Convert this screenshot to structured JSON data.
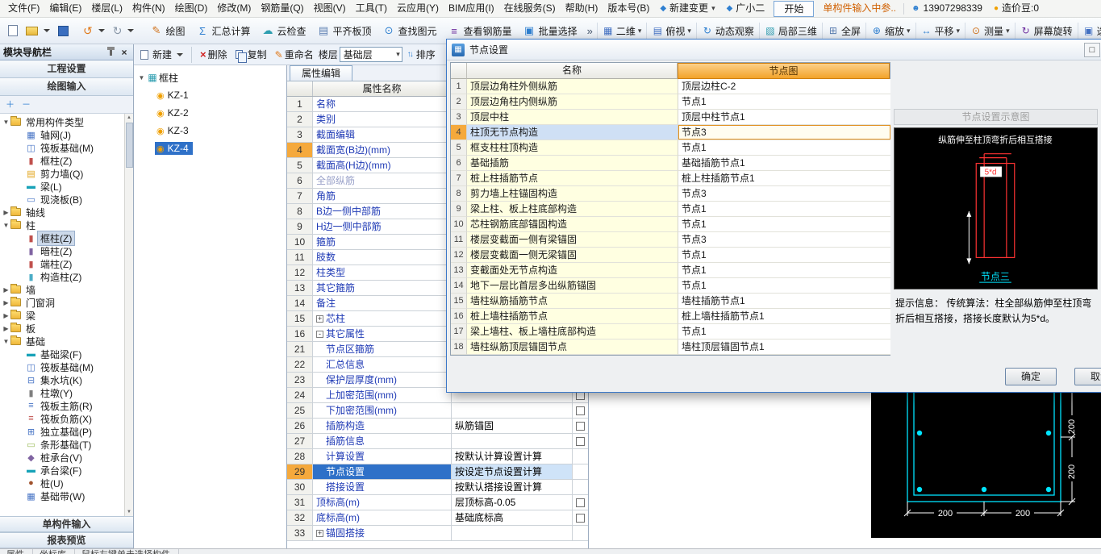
{
  "menubar": {
    "items": [
      "文件(F)",
      "编辑(E)",
      "楼层(L)",
      "构件(N)",
      "绘图(D)",
      "修改(M)",
      "钢筋量(Q)",
      "视图(V)",
      "工具(T)",
      "云应用(Y)",
      "BIM应用(I)",
      "在线服务(S)",
      "帮助(H)",
      "版本号(B)"
    ],
    "new_change": "新建变更",
    "assistant": "广小二",
    "start_tab": "开始",
    "notice": "单构件输入中参..",
    "phone": "13907298339",
    "coin": "造价豆:0"
  },
  "toolbar": {
    "items": [
      {
        "label": "绘图",
        "glyph": "✎",
        "color": "#d07018"
      },
      {
        "label": "汇总计算",
        "glyph": "Σ",
        "color": "#2e7fd0"
      },
      {
        "label": "云检查",
        "glyph": "☁",
        "color": "#2e9eb0"
      },
      {
        "label": "平齐板顶",
        "glyph": "▤",
        "color": "#5a7db0"
      },
      {
        "label": "查找图元",
        "glyph": "⊙",
        "color": "#2e7fd0"
      },
      {
        "label": "查看钢筋量",
        "glyph": "≡",
        "color": "#7030a0"
      },
      {
        "label": "批量选择",
        "glyph": "▣",
        "color": "#2e7fd0"
      }
    ],
    "view_items": [
      {
        "label": "二维",
        "glyph": "▦",
        "color": "#4472c4",
        "arrow": "▾"
      },
      {
        "label": "俯视",
        "glyph": "▤",
        "color": "#4472c4",
        "arrow": "▾"
      },
      {
        "label": "动态观察",
        "glyph": "↻",
        "color": "#2e7fd0",
        "arrow": ""
      },
      {
        "label": "局部三维",
        "glyph": "▧",
        "color": "#2e9eb0",
        "arrow": ""
      },
      {
        "label": "全屏",
        "glyph": "⊞",
        "color": "#5a7db0",
        "arrow": ""
      },
      {
        "label": "缩放",
        "glyph": "⊕",
        "color": "#2e7fd0",
        "arrow": "▾"
      },
      {
        "label": "平移",
        "glyph": "↔",
        "color": "#2e7fd0",
        "arrow": "▾"
      },
      {
        "label": "测量",
        "glyph": "⊙",
        "color": "#d07018",
        "arrow": "▾"
      },
      {
        "label": "屏幕旋转",
        "glyph": "↻",
        "color": "#7030a0",
        "arrow": ""
      },
      {
        "label": "选择样式",
        "glyph": "▣",
        "color": "#4472c4",
        "arrow": ""
      }
    ]
  },
  "glyphs": {
    "close": "×",
    "maximize": "□",
    "chevron": "»",
    "undo": "↺",
    "redo": "↻",
    "expand_all": "＋",
    "collapse_all": "－",
    "sort": "↑↓",
    "delete_x": "×",
    "rename": "✎",
    "scroll_up": "▲",
    "scroll_down": "▼",
    "dialog_icon": "▦",
    "person": "☻",
    "coin_dot": "●",
    "diamond": "◆",
    "root_tri": "▼"
  },
  "left_panel": {
    "title": "模块导航栏",
    "buttons": [
      "工程设置",
      "绘图输入"
    ],
    "tree": [
      {
        "label": "常用构件类型",
        "expand": "▼",
        "folder": true
      },
      {
        "label": "轴网(J)",
        "child": true,
        "glyph": "▦",
        "color": "#4472c4"
      },
      {
        "label": "筏板基础(M)",
        "child": true,
        "glyph": "◫",
        "color": "#4472c4"
      },
      {
        "label": "框柱(Z)",
        "child": true,
        "glyph": "▮",
        "color": "#c0504d"
      },
      {
        "label": "剪力墙(Q)",
        "child": true,
        "glyph": "▤",
        "color": "#e2a317"
      },
      {
        "label": "梁(L)",
        "child": true,
        "glyph": "▬",
        "color": "#17a2b8"
      },
      {
        "label": "现浇板(B)",
        "child": true,
        "glyph": "▭",
        "color": "#4472c4"
      },
      {
        "label": "轴线",
        "expand": "▶",
        "folder": true
      },
      {
        "label": "柱",
        "expand": "▼",
        "folder": true
      },
      {
        "label": "框柱(Z)",
        "child": true,
        "glyph": "▮",
        "color": "#c0504d",
        "selected": true
      },
      {
        "label": "暗柱(Z)",
        "child": true,
        "glyph": "▮",
        "color": "#8064a2"
      },
      {
        "label": "端柱(Z)",
        "child": true,
        "glyph": "▮",
        "color": "#c0504d"
      },
      {
        "label": "构造柱(Z)",
        "child": true,
        "glyph": "▮",
        "color": "#4bacc6"
      },
      {
        "label": "墙",
        "expand": "▶",
        "folder": true
      },
      {
        "label": "门窗洞",
        "expand": "▶",
        "folder": true
      },
      {
        "label": "梁",
        "expand": "▶",
        "folder": true
      },
      {
        "label": "板",
        "expand": "▶",
        "folder": true
      },
      {
        "label": "基础",
        "expand": "▼",
        "folder": true
      },
      {
        "label": "基础梁(F)",
        "child": true,
        "glyph": "▬",
        "color": "#17a2b8"
      },
      {
        "label": "筏板基础(M)",
        "child": true,
        "glyph": "◫",
        "color": "#4472c4"
      },
      {
        "label": "集水坑(K)",
        "child": true,
        "glyph": "⊟",
        "color": "#4472c4"
      },
      {
        "label": "柱墩(Y)",
        "child": true,
        "glyph": "▮",
        "color": "#7f7f7f"
      },
      {
        "label": "筏板主筋(R)",
        "child": true,
        "glyph": "≡",
        "color": "#4472c4"
      },
      {
        "label": "筏板负筋(X)",
        "child": true,
        "glyph": "≡",
        "color": "#c0504d"
      },
      {
        "label": "独立基础(P)",
        "child": true,
        "glyph": "⊞",
        "color": "#4472c4"
      },
      {
        "label": "条形基础(T)",
        "child": true,
        "glyph": "▭",
        "color": "#9bbb59"
      },
      {
        "label": "桩承台(V)",
        "child": true,
        "glyph": "◆",
        "color": "#8064a2"
      },
      {
        "label": "承台梁(F)",
        "child": true,
        "glyph": "▬",
        "color": "#17a2b8"
      },
      {
        "label": "桩(U)",
        "child": true,
        "glyph": "●",
        "color": "#a0522d"
      },
      {
        "label": "基础带(W)",
        "child": true,
        "glyph": "▦",
        "color": "#4472c4"
      }
    ],
    "bottom_buttons": [
      "单构件输入",
      "报表预览"
    ]
  },
  "component_panel": {
    "toolbar": {
      "new": "新建",
      "del": "删除",
      "copy": "复制",
      "rename": "重命名",
      "floor_label": "楼层",
      "floor_value": "基础层",
      "sort": "排序"
    },
    "root": "框柱",
    "item_glyph": "◉",
    "items": [
      {
        "name": "KZ-1"
      },
      {
        "name": "KZ-2"
      },
      {
        "name": "KZ-3"
      },
      {
        "name": "KZ-4",
        "selected": true
      }
    ]
  },
  "properties": {
    "tab": "属性编辑",
    "header": "属性名称",
    "rows": [
      {
        "num": "1",
        "name": "名称"
      },
      {
        "num": "2",
        "name": "类别"
      },
      {
        "num": "3",
        "name": "截面编辑"
      },
      {
        "num": "4",
        "name": "截面宽(B边)(mm)",
        "num_hl": true
      },
      {
        "num": "5",
        "name": "截面高(H边)(mm)"
      },
      {
        "num": "6",
        "name": "全部纵筋",
        "gray": true
      },
      {
        "num": "7",
        "name": "角筋"
      },
      {
        "num": "8",
        "name": "B边一侧中部筋"
      },
      {
        "num": "9",
        "name": "H边一侧中部筋"
      },
      {
        "num": "10",
        "name": "箍筋"
      },
      {
        "num": "11",
        "name": "肢数"
      },
      {
        "num": "12",
        "name": "柱类型"
      },
      {
        "num": "13",
        "name": "其它箍筋"
      },
      {
        "num": "14",
        "name": "备注"
      },
      {
        "num": "15",
        "name": "芯柱",
        "prefix": "+"
      },
      {
        "num": "16",
        "name": "其它属性",
        "prefix": "-"
      },
      {
        "num": "21",
        "name": "节点区箍筋",
        "indent": true
      },
      {
        "num": "22",
        "name": "汇总信息",
        "indent": true
      },
      {
        "num": "23",
        "name": "保护层厚度(mm)",
        "indent": true,
        "checkbox": true
      },
      {
        "num": "24",
        "name": "上加密范围(mm)",
        "indent": true,
        "checkbox": true
      },
      {
        "num": "25",
        "name": "下加密范围(mm)",
        "indent": true,
        "checkbox": true
      },
      {
        "num": "26",
        "name": "插筋构造",
        "value": "纵筋锚固",
        "indent": true,
        "checkbox": true
      },
      {
        "num": "27",
        "name": "插筋信息",
        "indent": true,
        "checkbox": true
      },
      {
        "num": "28",
        "name": "计算设置",
        "value": "按默认计算设置计算",
        "indent": true
      },
      {
        "num": "29",
        "name": "节点设置",
        "value": "按设定节点设置计算",
        "indent": true,
        "selected": true
      },
      {
        "num": "30",
        "name": "搭接设置",
        "value": "按默认搭接设置计算",
        "indent": true
      },
      {
        "num": "31",
        "name": "顶标高(m)",
        "value": "层顶标高-0.05",
        "checkbox": true
      },
      {
        "num": "32",
        "name": "底标高(m)",
        "value": "基础底标高",
        "checkbox": true
      },
      {
        "num": "33",
        "name": "锚固搭接",
        "prefix": "+"
      }
    ]
  },
  "dialog": {
    "title": "节点设置",
    "table": {
      "col_name": "名称",
      "col_node": "节点图",
      "rows": [
        {
          "num": "1",
          "name": "顶层边角柱外侧纵筋",
          "value": "顶层边柱C-2"
        },
        {
          "num": "2",
          "name": "顶层边角柱内侧纵筋",
          "value": "节点1"
        },
        {
          "num": "3",
          "name": "顶层中柱",
          "value": "顶层中柱节点1"
        },
        {
          "num": "4",
          "name": "柱顶无节点构造",
          "value": "节点3",
          "selected": true
        },
        {
          "num": "5",
          "name": "框支柱柱顶构造",
          "value": "节点1"
        },
        {
          "num": "6",
          "name": "基础插筋",
          "value": "基础插筋节点1"
        },
        {
          "num": "7",
          "name": "桩上柱插筋节点",
          "value": "桩上柱插筋节点1"
        },
        {
          "num": "8",
          "name": "剪力墙上柱锚固构造",
          "value": "节点3"
        },
        {
          "num": "9",
          "name": "梁上柱、板上柱底部构造",
          "value": "节点1"
        },
        {
          "num": "10",
          "name": "芯柱钢筋底部锚固构造",
          "value": "节点1"
        },
        {
          "num": "11",
          "name": "楼层变截面一侧有梁锚固",
          "value": "节点3"
        },
        {
          "num": "12",
          "name": "楼层变截面一侧无梁锚固",
          "value": "节点1"
        },
        {
          "num": "13",
          "name": "变截面处无节点构造",
          "value": "节点1"
        },
        {
          "num": "14",
          "name": "地下一层比首层多出纵筋锚固",
          "value": "节点1"
        },
        {
          "num": "15",
          "name": "墙柱纵筋插筋节点",
          "value": "墙柱插筋节点1"
        },
        {
          "num": "16",
          "name": "桩上墙柱插筋节点",
          "value": "桩上墙柱插筋节点1"
        },
        {
          "num": "17",
          "name": "梁上墙柱、板上墙柱底部构造",
          "value": "节点1"
        },
        {
          "num": "18",
          "name": "墙柱纵筋顶层锚固节点",
          "value": "墙柱顶层锚固节点1"
        }
      ]
    },
    "preview": {
      "title": "节点设置示意图",
      "caption": "纵筋伸至柱顶弯折后相互搭接",
      "dim_label": "5*d",
      "node_label": "节点三",
      "hint_label": "提示信息：",
      "hint_text": "传统算法：柱全部纵筋伸至柱顶弯折后相互搭接，搭接长度默认为5*d。"
    },
    "ok": "确定",
    "cancel": "取消"
  },
  "cad": {
    "dims_bottom": [
      "200",
      "200"
    ],
    "dims_right": [
      "200",
      "200"
    ]
  },
  "statusbar": {
    "items": [
      "属性",
      "坐标库",
      "鼠标左键单击选择构件"
    ]
  }
}
